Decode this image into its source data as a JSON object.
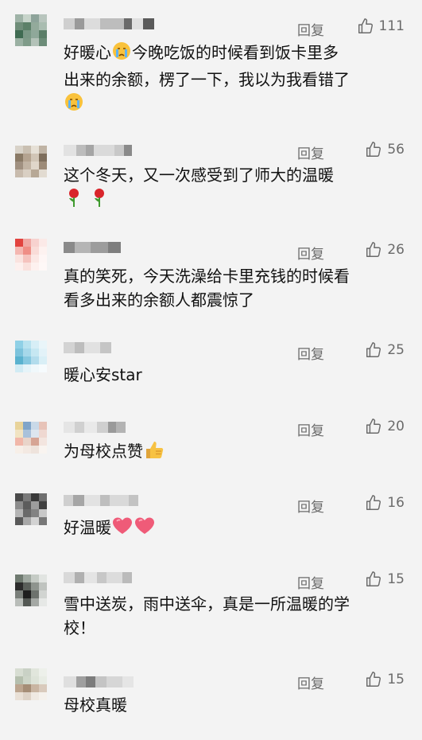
{
  "reply_label": "回复",
  "comments": [
    {
      "likes": "111",
      "lines": [
        "好暖心",
        "今晚吃饭的时候看到饭卡里多",
        "出来的余额，楞了一下，我以为我看错了"
      ],
      "emoji": "crying-face"
    },
    {
      "likes": "56",
      "lines": [
        "这个冬天，又一次感受到了师大的温暖"
      ],
      "emoji": "rose"
    },
    {
      "likes": "26",
      "lines": [
        "真的笑死，今天洗澡给卡里充钱的时候看",
        "看多出来的余额人都震惊了"
      ]
    },
    {
      "likes": "25",
      "lines": [
        "暖心安star"
      ]
    },
    {
      "likes": "20",
      "lines": [
        "为母校点赞"
      ],
      "emoji": "thumbs-up"
    },
    {
      "likes": "16",
      "lines": [
        "好温暖"
      ],
      "emoji": "heart"
    },
    {
      "likes": "15",
      "lines": [
        "雪中送炭，雨中送伞，真是一所温暖的学",
        "校！"
      ]
    },
    {
      "likes": "15",
      "lines": [
        "母校真暖"
      ]
    }
  ],
  "colors": {
    "background": "#f3f3f3",
    "meta": "#6b6b6b",
    "text": "#111111"
  }
}
